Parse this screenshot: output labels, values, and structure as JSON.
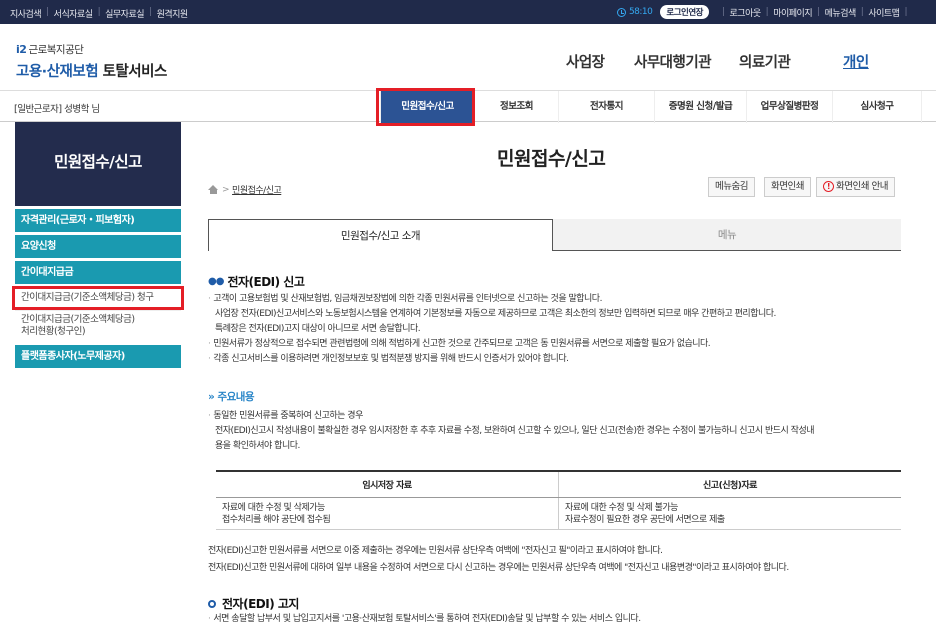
{
  "topbar": {
    "links": [
      "지사검색",
      "서식자료실",
      "실무자료실",
      "원격지원"
    ],
    "timer": "58:10",
    "extend": "로그인연장",
    "right_links": [
      "로그아웃",
      "마이페이지",
      "메뉴검색",
      "사이트맵"
    ]
  },
  "logo": {
    "line1": "근로복지공단",
    "brand": "고용·산재보험",
    "service": "토탈서비스"
  },
  "gnav": [
    "사업장",
    "사무대행기관",
    "의료기관",
    "개인"
  ],
  "user": {
    "name": "[일반근로자] 성병학 님"
  },
  "menu": [
    "민원접수/신고",
    "정보조회",
    "전자통지",
    "증명원 신청/발급",
    "업무상질병판정",
    "심사청구"
  ],
  "side": {
    "title": "민원접수/신고",
    "items": [
      "자격관리(근로자・피보험자)",
      "요양신청",
      "간이대지급금"
    ],
    "sub1": "간이대지급금(기준소액체당금) 청구",
    "sub2a": "간이대지급금(기준소액체당금)",
    "sub2b": "처리현황(청구인)",
    "item4": "플랫폼종사자(노무제공자)"
  },
  "page": {
    "title": "민원접수/신고",
    "crumb": "민원접수/신고",
    "btn_menu": "메뉴숨김",
    "btn_print": "화면인쇄",
    "btn_guide": "화면인쇄 안내",
    "tab1": "민원접수/신고 소개",
    "tab2": "메뉴"
  },
  "edi": {
    "heading": "전자(EDI) 신고",
    "lines": [
      "고객이 고용보험법 및 산재보험법, 임금채권보장법에 의한 각종 민원서류를 인터넷으로 신고하는 것을 말합니다.",
      "사업장 전자(EDI)신고서비스와 노동보험시스템을 연계하여 기본정보를 자동으로 제공하므로 고객은 최소한의 정보만 입력하면 되므로 매우 간편하고 편리합니다.",
      "특례장은 전자(EDI)고지 대상이 아니므로 서면 송달합니다.",
      "민원서류가 정상적으로 접수되면 관련법령에 의해 적법하게 신고한 것으로 간주되므로 고객은 동 민원서류를 서면으로 제출할 필요가 없습니다.",
      "각종 신고서비스를 이용하려면 개인정보보호 및 법적분쟁 방지를 위해 반드시 인증서가 있어야 합니다."
    ],
    "sub": "주요내용",
    "sub_lines": [
      "동일한 민원서류를 중복하여 신고하는 경우",
      "전자(EDI)신고시 작성내용이 불확실한 경우 임시저장한 후 추후 자료를 수정, 보완하여 신고할 수 있으나, 일단 신고(전송)한 경우는 수정이 불가능하니 신고시 반드시 작성내",
      "용을 확인하셔야 합니다."
    ],
    "table": {
      "h1": "임시저장 자료",
      "h2": "신고(신청)자료",
      "r1c1": "자료에 대한 수정 및 삭제가능",
      "r1c2": "자료에 대한 수정 및 삭제 불가능",
      "r2c1": "접수처리를 해야 공단에 접수됨",
      "r2c2": "자료수정이 필요한 경우 공단에 서면으로 제출"
    },
    "after": [
      "전자(EDI)신고한 민원서류를 서면으로 이중 제출하는 경우에는 민원서류 상단우측 여백에 \"전자신고 필\"이라고 표시하여야 합니다.",
      "전자(EDI)신고한 민원서류에 대하여 일부 내용을 수정하여 서면으로 다시 신고하는 경우에는 민원서류 상단우측 여백에 \"전자신고 내용변경\"이라고 표시하여야 합니다."
    ]
  },
  "notice": {
    "heading": "전자(EDI) 고지",
    "line": "서면 송달할 납부서 및 납입고지서를 '고용·산재보험 토탈서비스'를 통하여 전자(EDI)송달 및 납부할 수 있는 서비스 입니다."
  }
}
